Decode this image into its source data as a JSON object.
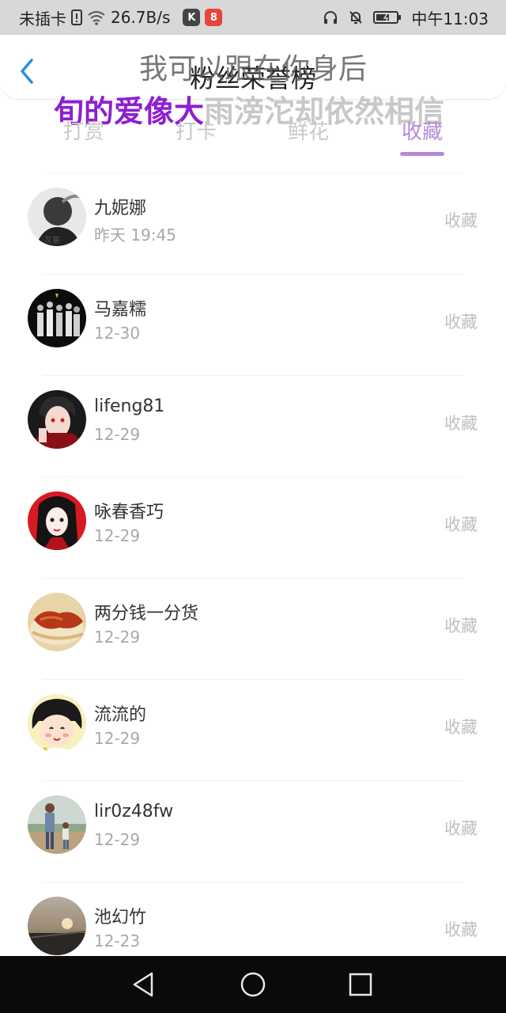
{
  "status_bar": {
    "carrier": "未插卡",
    "speed": "26.7B/s",
    "time": "中午11:03",
    "icons": [
      "sim-alert-icon",
      "wifi-icon",
      "app-k-icon",
      "app-8-icon",
      "headphone-icon",
      "mute-bell-icon",
      "battery-icon"
    ]
  },
  "header": {
    "title": "粉丝荣誉榜",
    "back_icon": "chevron-left-icon"
  },
  "lyrics": {
    "line1": "我可以跟在你身后",
    "line2_highlight": "旬的爱像大",
    "line2_rest": "雨滂沱却依然相信"
  },
  "tabs": [
    {
      "label": "打赏",
      "active": false
    },
    {
      "label": "打卡",
      "active": false
    },
    {
      "label": "鲜花",
      "active": false
    },
    {
      "label": "收藏",
      "active": true
    }
  ],
  "accent_color": "#b48ad8",
  "list": [
    {
      "name": "九妮娜",
      "date": "昨天 19:45",
      "action": "收藏",
      "avatar": "avatar-gray-smoke"
    },
    {
      "name": "马嘉糯",
      "date": "12-30",
      "action": "收藏",
      "avatar": "avatar-group-dark"
    },
    {
      "name": "lifeng81",
      "date": "12-29",
      "action": "收藏",
      "avatar": "avatar-anime-red"
    },
    {
      "name": "咏春香巧",
      "date": "12-29",
      "action": "收藏",
      "avatar": "avatar-girl-red"
    },
    {
      "name": "两分钱一分货",
      "date": "12-29",
      "action": "收藏",
      "avatar": "avatar-food"
    },
    {
      "name": "流流的",
      "date": "12-29",
      "action": "收藏",
      "avatar": "avatar-cartoon-girl"
    },
    {
      "name": "lir0z48fw",
      "date": "12-29",
      "action": "收藏",
      "avatar": "avatar-family-photo"
    },
    {
      "name": "池幻竹",
      "date": "12-23",
      "action": "收藏",
      "avatar": "avatar-sunset"
    }
  ],
  "nav_bar": {
    "buttons": [
      "back-triangle-icon",
      "home-circle-icon",
      "recents-square-icon"
    ]
  }
}
